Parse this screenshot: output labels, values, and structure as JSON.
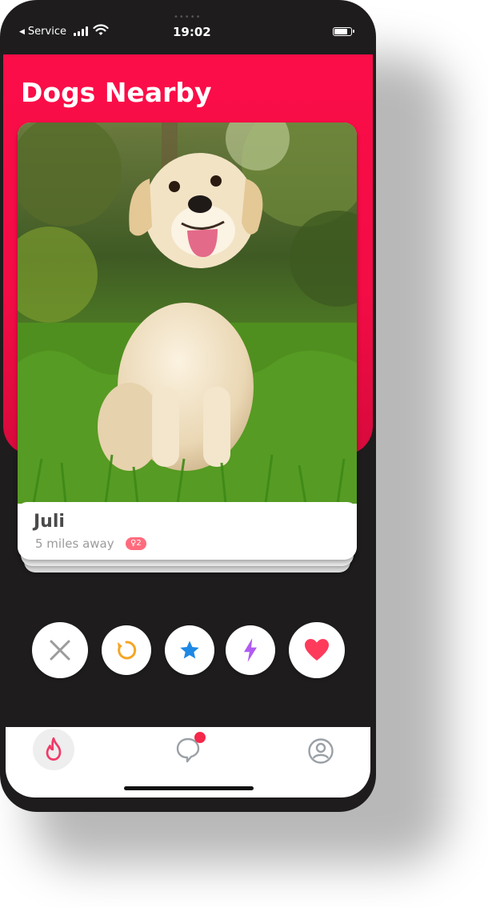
{
  "status_bar": {
    "carrier": "Service",
    "time": "19:02"
  },
  "header": {
    "title": "Dogs Nearby"
  },
  "card": {
    "name": "Juli",
    "distance": "5 miles away",
    "badge": "2"
  },
  "actions": [
    {
      "name": "nope",
      "icon": "close-icon",
      "color": "#9b9b9b"
    },
    {
      "name": "rewind",
      "icon": "rewind-icon",
      "color": "#f5a623"
    },
    {
      "name": "super-like",
      "icon": "star-icon",
      "color": "#1e88e5"
    },
    {
      "name": "boost",
      "icon": "lightning-icon",
      "color": "#b05cf0"
    },
    {
      "name": "like",
      "icon": "heart-icon",
      "color": "#ff3b5c"
    }
  ],
  "nav": [
    {
      "name": "discover",
      "icon": "flame-icon",
      "active": true
    },
    {
      "name": "messages",
      "icon": "chat-icon",
      "has_notification": true
    },
    {
      "name": "profile",
      "icon": "profile-icon"
    }
  ],
  "colors": {
    "brand": "#fb0d48",
    "phone_body": "#1e1c1d"
  }
}
